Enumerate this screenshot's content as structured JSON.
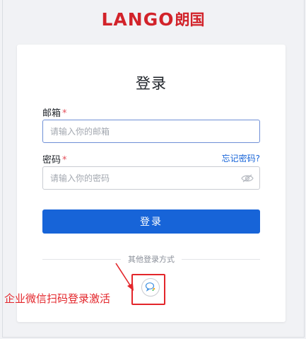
{
  "logo": {
    "latin": "LANGO",
    "chinese": "朗国"
  },
  "login": {
    "title": "登录",
    "email": {
      "label": "邮箱",
      "required_mark": "*",
      "placeholder": "请输入你的邮箱",
      "value": ""
    },
    "password": {
      "label": "密码",
      "required_mark": "*",
      "placeholder": "请输入你的密码",
      "value": "",
      "forgot_label": "忘记密码?"
    },
    "submit_label": "登录",
    "other_methods_label": "其他登录方式"
  },
  "annotation": {
    "text": "企业微信扫码登录激活"
  },
  "icons": {
    "password_toggle": "eye-icon",
    "wecom": "wecom-icon"
  },
  "colors": {
    "brand": "#d2232a",
    "primary": "#1764d8",
    "annotation": "#e3262b",
    "required": "#e34d59"
  }
}
